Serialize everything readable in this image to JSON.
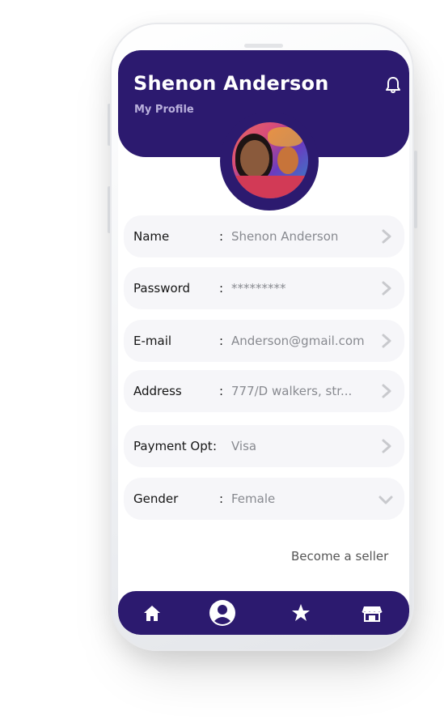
{
  "header": {
    "user_name": "Shenon Anderson",
    "subtitle": "My Profile",
    "notification_icon": "bell-icon"
  },
  "profile": {
    "avatar_icon": "user-photo"
  },
  "fields": [
    {
      "label": "Name",
      "value": "Shenon Anderson",
      "control": "chevron-right-icon"
    },
    {
      "label": "Password",
      "value": "*********",
      "control": "chevron-right-icon"
    },
    {
      "label": "E-mail",
      "value": "Anderson@gmail.com",
      "control": "chevron-right-icon"
    },
    {
      "label": "Address",
      "value": "777/D walkers, str...",
      "control": "chevron-right-icon"
    },
    {
      "label": "Payment Opt",
      "value": "Visa",
      "control": "chevron-right-icon"
    },
    {
      "label": "Gender",
      "value": "Female",
      "control": "chevron-down-icon"
    }
  ],
  "separator": ":",
  "become_seller": "Become a seller",
  "bottom_nav": {
    "items": [
      {
        "icon": "home-icon",
        "active": false
      },
      {
        "icon": "profile-icon",
        "active": true
      },
      {
        "icon": "star-icon",
        "active": false
      },
      {
        "icon": "store-icon",
        "active": false
      }
    ]
  },
  "colors": {
    "primary": "#2c1a6f",
    "row_background": "#f6f6f9",
    "value_text": "#888a90",
    "subtitle_text": "#b9b0dc"
  }
}
